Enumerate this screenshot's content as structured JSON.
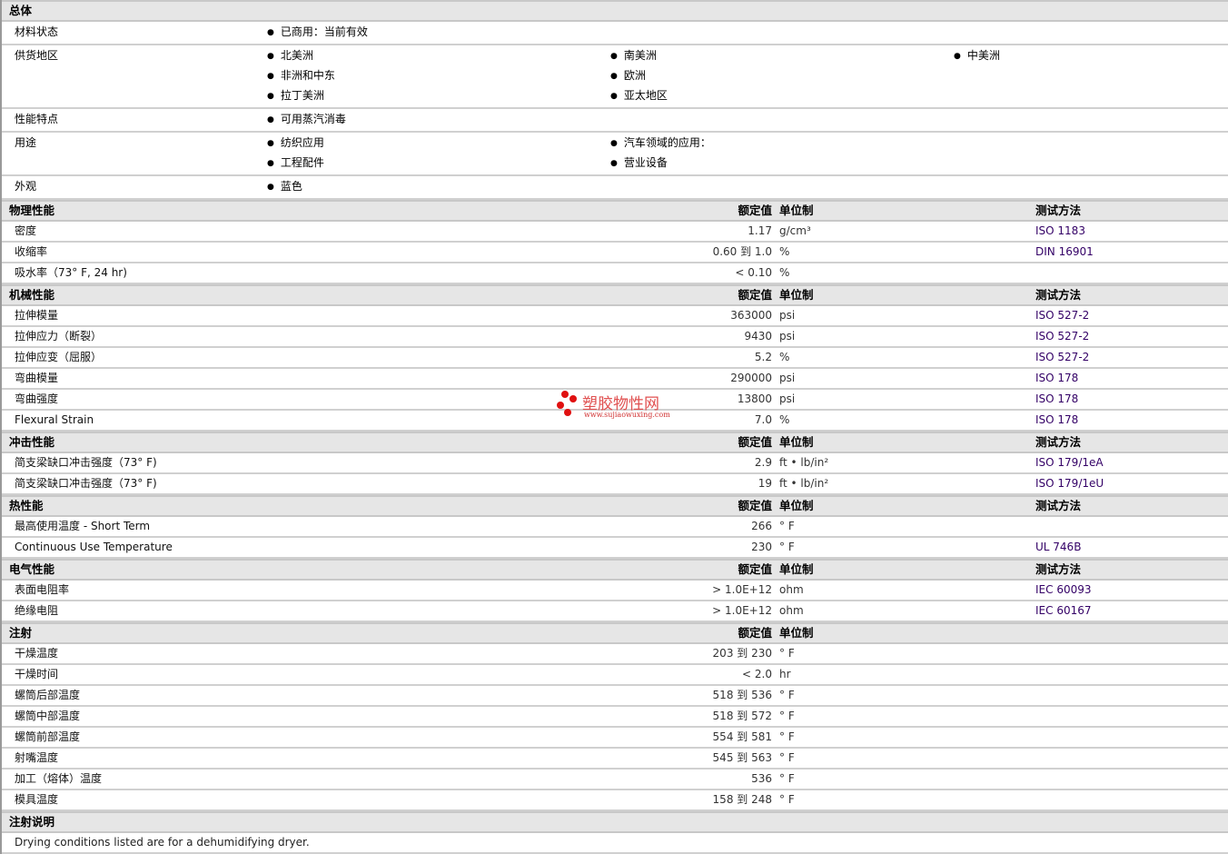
{
  "general": {
    "title": "总体",
    "rows": [
      {
        "label": "材料状态",
        "items": [
          "已商用：当前有效"
        ]
      },
      {
        "label": "供货地区",
        "items": [
          "北美洲",
          "南美洲",
          "中美洲",
          "非洲和中东",
          "欧洲",
          "",
          "拉丁美洲",
          "亚太地区"
        ]
      },
      {
        "label": "性能特点",
        "items": [
          "可用蒸汽消毒"
        ]
      },
      {
        "label": "用途",
        "items": [
          "纺织应用",
          "汽车领域的应用：",
          "",
          "工程配件",
          "营业设备"
        ]
      },
      {
        "label": "外观",
        "items": [
          "蓝色"
        ]
      }
    ]
  },
  "column_headers": {
    "value": "额定值",
    "unit": "单位制",
    "method": "测试方法"
  },
  "sections": [
    {
      "title": "物理性能",
      "show_method": true,
      "rows": [
        {
          "label": "密度",
          "value": "1.17",
          "unit": "g/cm³",
          "method": "ISO 1183"
        },
        {
          "label": "收缩率",
          "value": "0.60 到  1.0",
          "unit": "%",
          "method": "DIN 16901"
        },
        {
          "label": "吸水率（73° F, 24 hr)",
          "value": "< 0.10",
          "unit": "%",
          "method": ""
        }
      ]
    },
    {
      "title": "机械性能",
      "show_method": true,
      "rows": [
        {
          "label": "拉伸模量",
          "value": "363000",
          "unit": "psi",
          "method": "ISO 527-2"
        },
        {
          "label": "拉伸应力（断裂）",
          "value": "9430",
          "unit": "psi",
          "method": "ISO 527-2"
        },
        {
          "label": "拉伸应变（屈服）",
          "value": "5.2",
          "unit": "%",
          "method": "ISO 527-2"
        },
        {
          "label": "弯曲模量",
          "value": "290000",
          "unit": "psi",
          "method": "ISO 178"
        },
        {
          "label": "弯曲强度",
          "value": "13800",
          "unit": "psi",
          "method": "ISO 178"
        },
        {
          "label": "Flexural Strain",
          "value": "7.0",
          "unit": "%",
          "method": "ISO 178"
        }
      ]
    },
    {
      "title": "冲击性能",
      "show_method": true,
      "rows": [
        {
          "label": "简支梁缺口冲击强度（73° F)",
          "value": "2.9",
          "unit": "ft • lb/in²",
          "method": "ISO 179/1eA"
        },
        {
          "label": "简支梁缺口冲击强度（73° F)",
          "value": "19",
          "unit": "ft • lb/in²",
          "method": "ISO 179/1eU"
        }
      ]
    },
    {
      "title": "热性能",
      "show_method": true,
      "rows": [
        {
          "label": "最高使用温度  - Short Term",
          "value": "266",
          "unit": "° F",
          "method": ""
        },
        {
          "label": "Continuous Use Temperature",
          "value": "230",
          "unit": "° F",
          "method": "UL 746B"
        }
      ]
    },
    {
      "title": "电气性能",
      "show_method": true,
      "rows": [
        {
          "label": "表面电阻率",
          "value": "> 1.0E+12",
          "unit": "ohm",
          "method": "IEC 60093"
        },
        {
          "label": "绝缘电阻",
          "value": "> 1.0E+12",
          "unit": "ohm",
          "method": "IEC 60167"
        }
      ]
    },
    {
      "title": "注射",
      "show_method": false,
      "rows": [
        {
          "label": "干燥温度",
          "value": "203 到  230",
          "unit": "° F",
          "method": ""
        },
        {
          "label": "干燥时间",
          "value": "< 2.0",
          "unit": "hr",
          "method": ""
        },
        {
          "label": "螺筒后部温度",
          "value": "518 到  536",
          "unit": "° F",
          "method": ""
        },
        {
          "label": "螺筒中部温度",
          "value": "518 到  572",
          "unit": "° F",
          "method": ""
        },
        {
          "label": "螺筒前部温度",
          "value": "554 到  581",
          "unit": "° F",
          "method": ""
        },
        {
          "label": "射嘴温度",
          "value": "545 到  563",
          "unit": "° F",
          "method": ""
        },
        {
          "label": "加工（熔体）温度",
          "value": "536",
          "unit": "° F",
          "method": ""
        },
        {
          "label": "模具温度",
          "value": "158 到  248",
          "unit": "° F",
          "method": ""
        }
      ]
    }
  ],
  "notes": {
    "title": "注射说明",
    "text": "Drying conditions listed are for a dehumidifying dryer."
  },
  "watermark": {
    "name": "塑胶物性网",
    "url": "www.sujiaowuxing.com"
  }
}
